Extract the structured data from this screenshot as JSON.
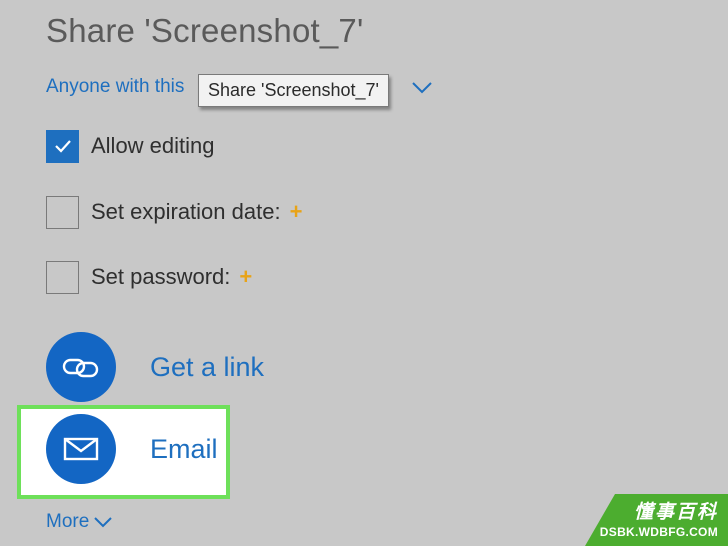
{
  "dialog": {
    "title": "Share 'Screenshot_7'",
    "permission_label": "Anyone with this",
    "tooltip": "Share 'Screenshot_7'"
  },
  "options": [
    {
      "label": "Allow editing",
      "checked": true,
      "has_plus": false
    },
    {
      "label": "Set expiration date:",
      "checked": false,
      "has_plus": true,
      "plus": "+"
    },
    {
      "label": "Set password:",
      "checked": false,
      "has_plus": true,
      "plus": "+"
    }
  ],
  "actions": [
    {
      "label": "Get a link",
      "icon": "link-icon"
    },
    {
      "label": "Email",
      "icon": "envelope-icon",
      "highlighted": true
    }
  ],
  "more_label": "More",
  "watermark": {
    "cn": "懂事百科",
    "en": "DSBK.WDBFG.COM"
  },
  "colors": {
    "background": "#c8c8c8",
    "accent": "#1e6fbf",
    "circle": "#1366c4",
    "plus": "#e8a317",
    "highlight_border": "#6ee05a",
    "watermark": "#4cad2f"
  }
}
